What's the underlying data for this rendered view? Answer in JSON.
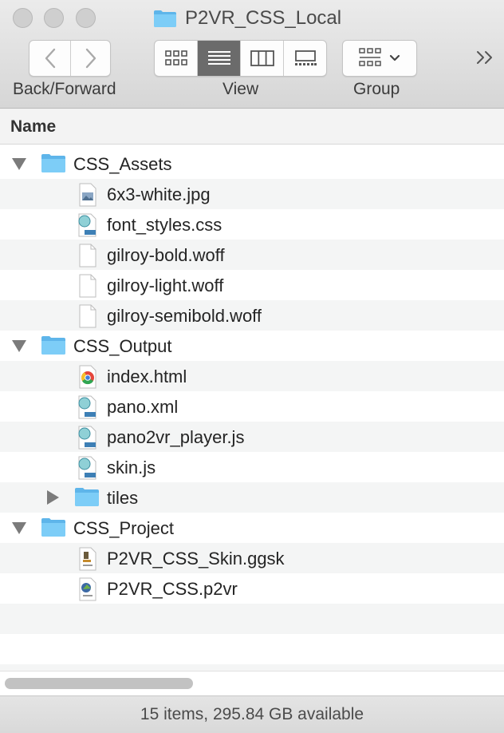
{
  "window": {
    "title": "P2VR_CSS_Local"
  },
  "toolbar": {
    "back_forward_label": "Back/Forward",
    "view_label": "View",
    "group_label": "Group"
  },
  "columns": {
    "name": "Name"
  },
  "rows": [
    {
      "label": "CSS_Assets",
      "kind": "folder",
      "expanded": true
    },
    {
      "label": "6x3-white.jpg",
      "kind": "image"
    },
    {
      "label": "font_styles.css",
      "kind": "text"
    },
    {
      "label": "gilroy-bold.woff",
      "kind": "blank"
    },
    {
      "label": "gilroy-light.woff",
      "kind": "blank"
    },
    {
      "label": "gilroy-semibold.woff",
      "kind": "blank"
    },
    {
      "label": "CSS_Output",
      "kind": "folder",
      "expanded": true
    },
    {
      "label": "index.html",
      "kind": "chrome"
    },
    {
      "label": "pano.xml",
      "kind": "text"
    },
    {
      "label": "pano2vr_player.js",
      "kind": "text"
    },
    {
      "label": "skin.js",
      "kind": "text"
    },
    {
      "label": "tiles",
      "kind": "folder",
      "expanded": false
    },
    {
      "label": "CSS_Project",
      "kind": "folder",
      "expanded": true
    },
    {
      "label": "P2VR_CSS_Skin.ggsk",
      "kind": "skin"
    },
    {
      "label": "P2VR_CSS.p2vr",
      "kind": "pano"
    }
  ],
  "status": {
    "text": "15 items, 295.84 GB available"
  },
  "colors": {
    "folder": "#6fc3f2",
    "active_view": "#6b6b6b"
  }
}
